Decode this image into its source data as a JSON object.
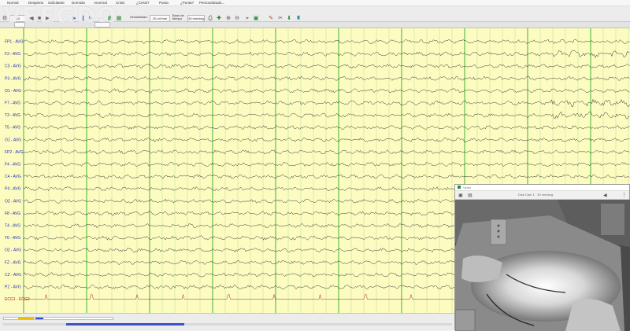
{
  "menu": [
    "Normal",
    "Despierto",
    "Solicitante",
    "Dormido",
    "Anormal",
    "Crisis",
    "¿Crisis?",
    "Punta",
    "¿Punta?",
    "Personalizado..."
  ],
  "toolbar": {
    "page_value": "10",
    "sensitivity_label": "Sensibilidad",
    "sensitivity_value": "20 uV/mm",
    "filter_label": "Base de tiempo",
    "timebase_value": "30 mm/seg"
  },
  "logo_text": "VEEGDO",
  "channels": [
    "FP1 - AVG",
    "F3 - AVG",
    "C3 - AVG",
    "P3 - AVG",
    "O1 - AVG",
    "F7 - AVG",
    "T3 - AVG",
    "T5 - AVG",
    "O1 - AVG",
    "FP2 - AVG",
    "F4 - AVG",
    "C4 - AVG",
    "P4 - AVG",
    "O2 - AVG",
    "F8 - AVG",
    "T4 - AVG",
    "T6 - AVG",
    "O2 - AVG",
    "FZ - AVG",
    "CZ - AVG",
    "PZ - AVG",
    "ECG1 - ECG2"
  ],
  "video": {
    "title": "Video",
    "status": "Disk Cam 1 · 30 mm/seg"
  },
  "colors": {
    "eeg_background": "#fdfcc0",
    "trace": "#333333",
    "channel_label": "#1f2fb0",
    "ecg_label": "#b01f1f",
    "grid_major": "#2aa82a",
    "grid_minor": "#8fbf8f"
  }
}
